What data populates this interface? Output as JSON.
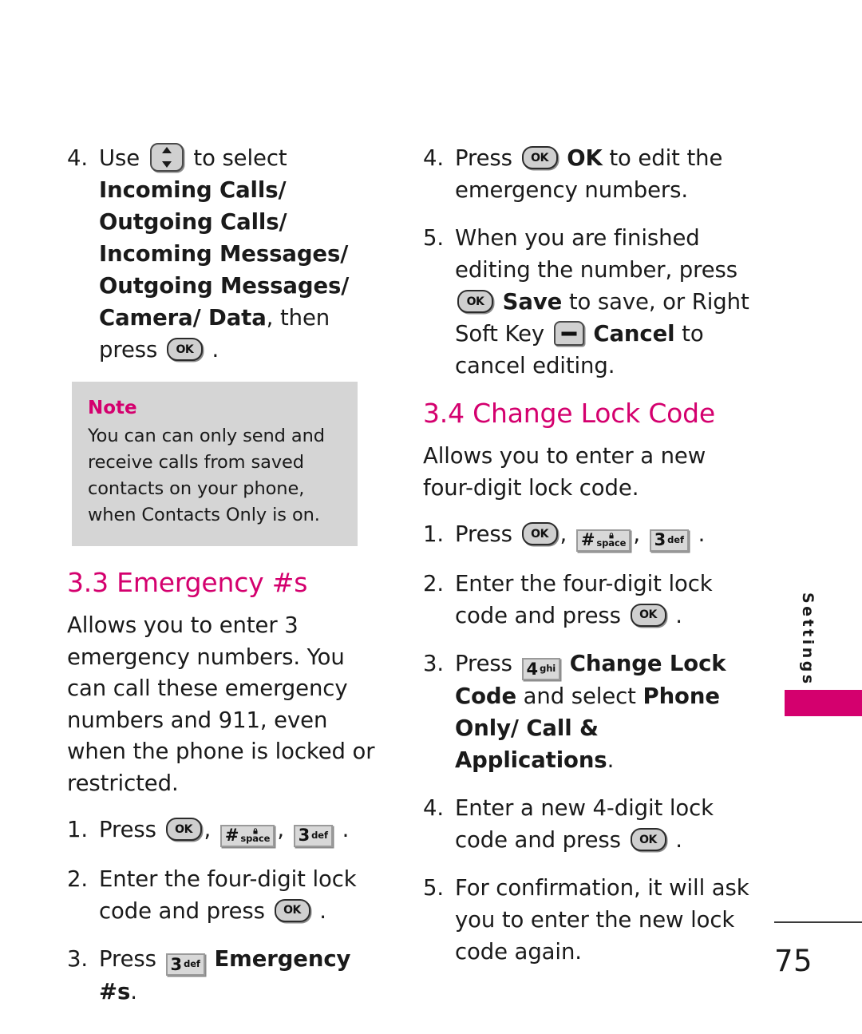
{
  "page": {
    "number": "75",
    "side_tab_label": "Settings",
    "accent_color": "#d4006e",
    "note_background": "#d5d5d5"
  },
  "icons": {
    "ok_key_label": "OK",
    "nav_key": "navigation-up-down-key",
    "soft_key": "right-soft-key",
    "hash_key": {
      "symbol": "#",
      "sub": "space",
      "lock": "lock-icon"
    },
    "three_key": {
      "digit": "3",
      "letters": "def"
    },
    "four_key": {
      "digit": "4",
      "letters": "ghi"
    }
  },
  "left_column": {
    "step4": {
      "num": "4.",
      "text_a": "Use",
      "text_b": "to select",
      "bold_list": "Incoming Calls/ Outgoing Calls/ Incoming Messages/ Outgoing Messages/ Camera/ Data",
      "text_c": ", then press",
      "text_d": "."
    },
    "note": {
      "title": "Note",
      "body": "You can can only send and receive calls from saved contacts on your phone, when Contacts Only is on."
    },
    "section": {
      "heading": "3.3 Emergency #s",
      "intro": "Allows you to enter 3 emergency numbers. You can call these emergency numbers and 911, even when the phone is locked or restricted.",
      "steps": [
        {
          "num": "1.",
          "text_a": "Press",
          "comma1": ",",
          "comma2": ",",
          "text_end": "."
        },
        {
          "num": "2.",
          "text_a": "Enter the four-digit lock code and press",
          "text_end": "."
        },
        {
          "num": "3.",
          "text_a": "Press",
          "bold": "Emergency #s",
          "text_end": "."
        }
      ]
    }
  },
  "right_column": {
    "step4": {
      "num": "4.",
      "text_a": "Press",
      "bold_ok": "OK",
      "text_b": "to edit the emergency numbers."
    },
    "step5": {
      "num": "5.",
      "text_a": "When you are finished editing the number, press",
      "bold_save": "Save",
      "text_b": "to save, or Right Soft Key",
      "bold_cancel": "Cancel",
      "text_c": "to cancel editing."
    },
    "section": {
      "heading": "3.4 Change Lock Code",
      "intro": "Allows you to enter a new four-digit lock code.",
      "steps": [
        {
          "num": "1.",
          "text_a": "Press",
          "comma1": ",",
          "comma2": ",",
          "text_end": "."
        },
        {
          "num": "2.",
          "text_a": "Enter the four-digit lock code and press",
          "text_end": "."
        },
        {
          "num": "3.",
          "text_a": "Press",
          "bold_a": "Change Lock Code",
          "text_b": "and select",
          "bold_b": "Phone Only/ Call & Applications",
          "text_end": "."
        },
        {
          "num": "4.",
          "text_a": "Enter a new 4-digit lock code and press",
          "text_end": "."
        },
        {
          "num": "5.",
          "text_a": "For confirmation, it will ask you to enter the new lock code again."
        }
      ]
    }
  }
}
